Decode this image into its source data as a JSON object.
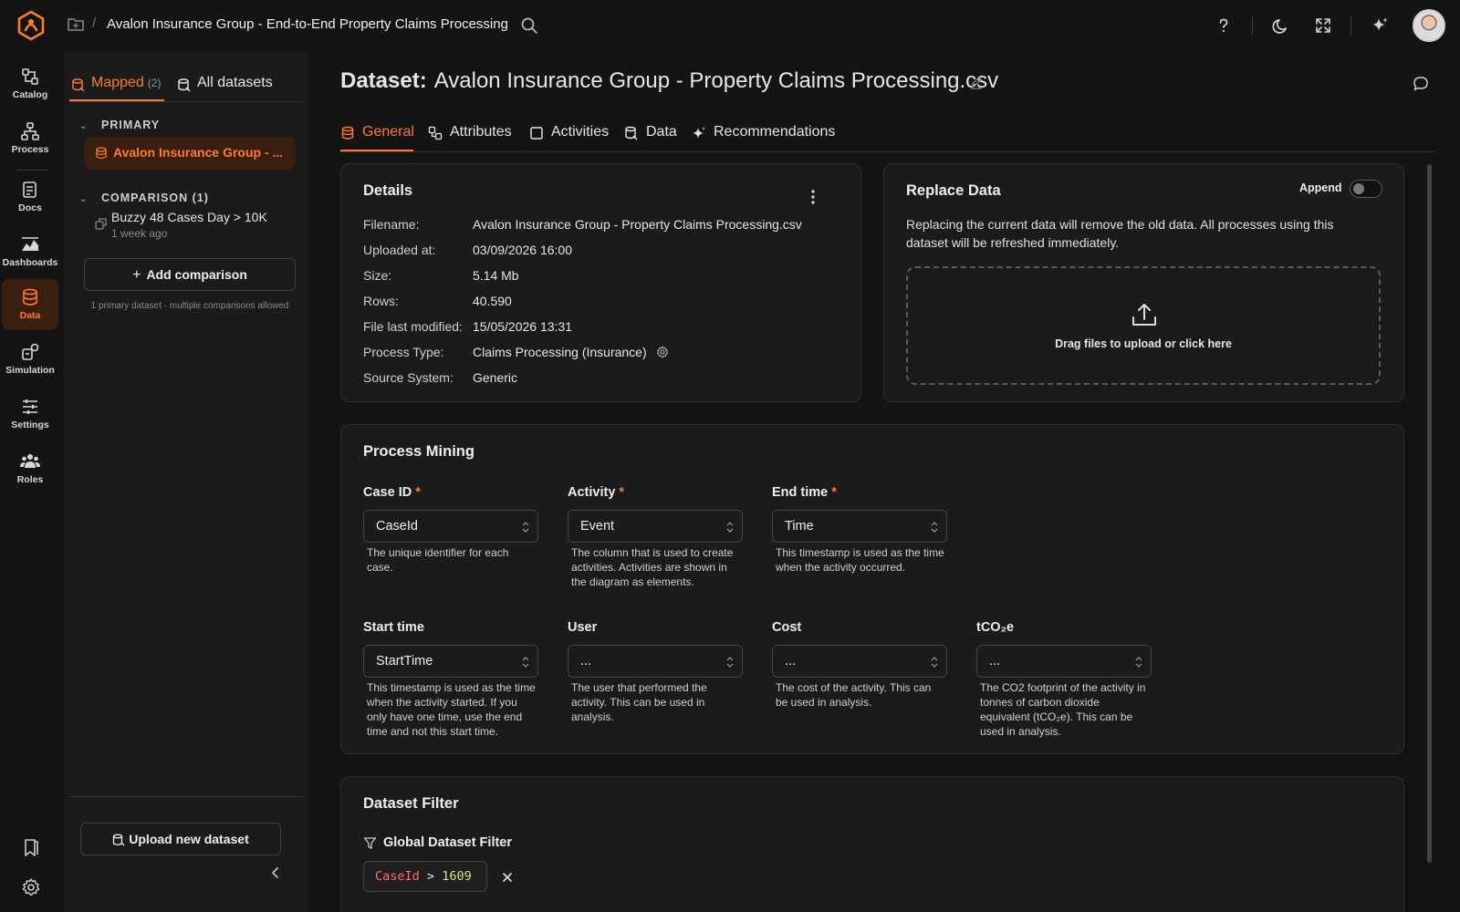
{
  "app": {
    "breadcrumb_sep": "/",
    "title": "Avalon Insurance Group - End-to-End Property Claims Processing",
    "accent": "#ff7a2f"
  },
  "rail": {
    "items": [
      {
        "label": "Catalog",
        "icon": "catalog-icon"
      },
      {
        "label": "Process",
        "icon": "process-icon"
      },
      {
        "label": "Docs",
        "icon": "docs-icon"
      },
      {
        "label": "Dashboards",
        "icon": "dashboards-icon"
      },
      {
        "label": "Data",
        "icon": "data-icon",
        "active": true
      },
      {
        "label": "Simulation",
        "icon": "simulation-icon"
      },
      {
        "label": "Settings",
        "icon": "settings-sliders-icon"
      },
      {
        "label": "Roles",
        "icon": "roles-icon"
      }
    ]
  },
  "sidebar": {
    "tab_mapped": "Mapped",
    "tab_mapped_count": "(2)",
    "tab_all": "All datasets",
    "primary_header": "PRIMARY",
    "primary_item": "Avalon Insurance Group - ...",
    "comparison_header": "COMPARISON (1)",
    "comparison_name": "Buzzy 48 Cases Day > 10K",
    "comparison_age": "1 week ago",
    "add_comparison": "Add comparison",
    "note": "1 primary dataset · multiple comparisons allowed",
    "upload_new": "Upload new dataset"
  },
  "main": {
    "title_prefix": "Dataset:",
    "title_name": "Avalon Insurance Group - Property Claims Processing.csv",
    "tabs": [
      {
        "label": "General",
        "active": true
      },
      {
        "label": "Attributes"
      },
      {
        "label": "Activities"
      },
      {
        "label": "Data"
      },
      {
        "label": "Recommendations"
      }
    ]
  },
  "details": {
    "title": "Details",
    "rows": [
      {
        "label": "Filename:",
        "value": "Avalon Insurance Group - Property Claims Processing.csv"
      },
      {
        "label": "Uploaded at:",
        "value": "03/09/2026 16:00"
      },
      {
        "label": "Size:",
        "value": "5.14 Mb"
      },
      {
        "label": "Rows:",
        "value": "40.590"
      },
      {
        "label": "File last modified:",
        "value": "15/05/2026 13:31"
      },
      {
        "label": "Process Type:",
        "value": "Claims Processing (Insurance)"
      },
      {
        "label": "Source System:",
        "value": "Generic"
      }
    ]
  },
  "replace": {
    "title": "Replace Data",
    "append_label": "Append",
    "append_on": false,
    "text": "Replacing the current data will remove the old data. All processes using this dataset will be refreshed immediately.",
    "dropzone": "Drag files to upload or click here"
  },
  "process_mining": {
    "title": "Process Mining",
    "fields": [
      {
        "label": "Case ID",
        "required": "*",
        "value": "CaseId",
        "hint": "The unique identifier for each case."
      },
      {
        "label": "Activity",
        "required": "*",
        "value": "Event",
        "hint": "The column that is used to create activities. Activities are shown in the diagram as elements."
      },
      {
        "label": "End time",
        "required": "*",
        "value": "Time",
        "hint": "This timestamp is used as the time when the activity occurred."
      },
      {
        "label": "Start time",
        "value": "StartTime",
        "hint": "This timestamp is used as the time when the activity started. If you only have one time, use the end time and not this start time."
      },
      {
        "label": "User",
        "value": "...",
        "hint": "The user that performed the activity. This can be used in analysis."
      },
      {
        "label": "Cost",
        "value": "...",
        "hint": "The cost of the activity. This can be used in analysis."
      },
      {
        "label": "tCO₂e",
        "value": "...",
        "hint": "The CO2 footprint of the activity in tonnes of carbon dioxide equivalent (tCO₂e). This can be used in analysis."
      }
    ]
  },
  "filter": {
    "title": "Dataset Filter",
    "global_label": "Global Dataset Filter",
    "chip_key": "CaseId",
    "chip_op": ">",
    "chip_val": "1609"
  }
}
